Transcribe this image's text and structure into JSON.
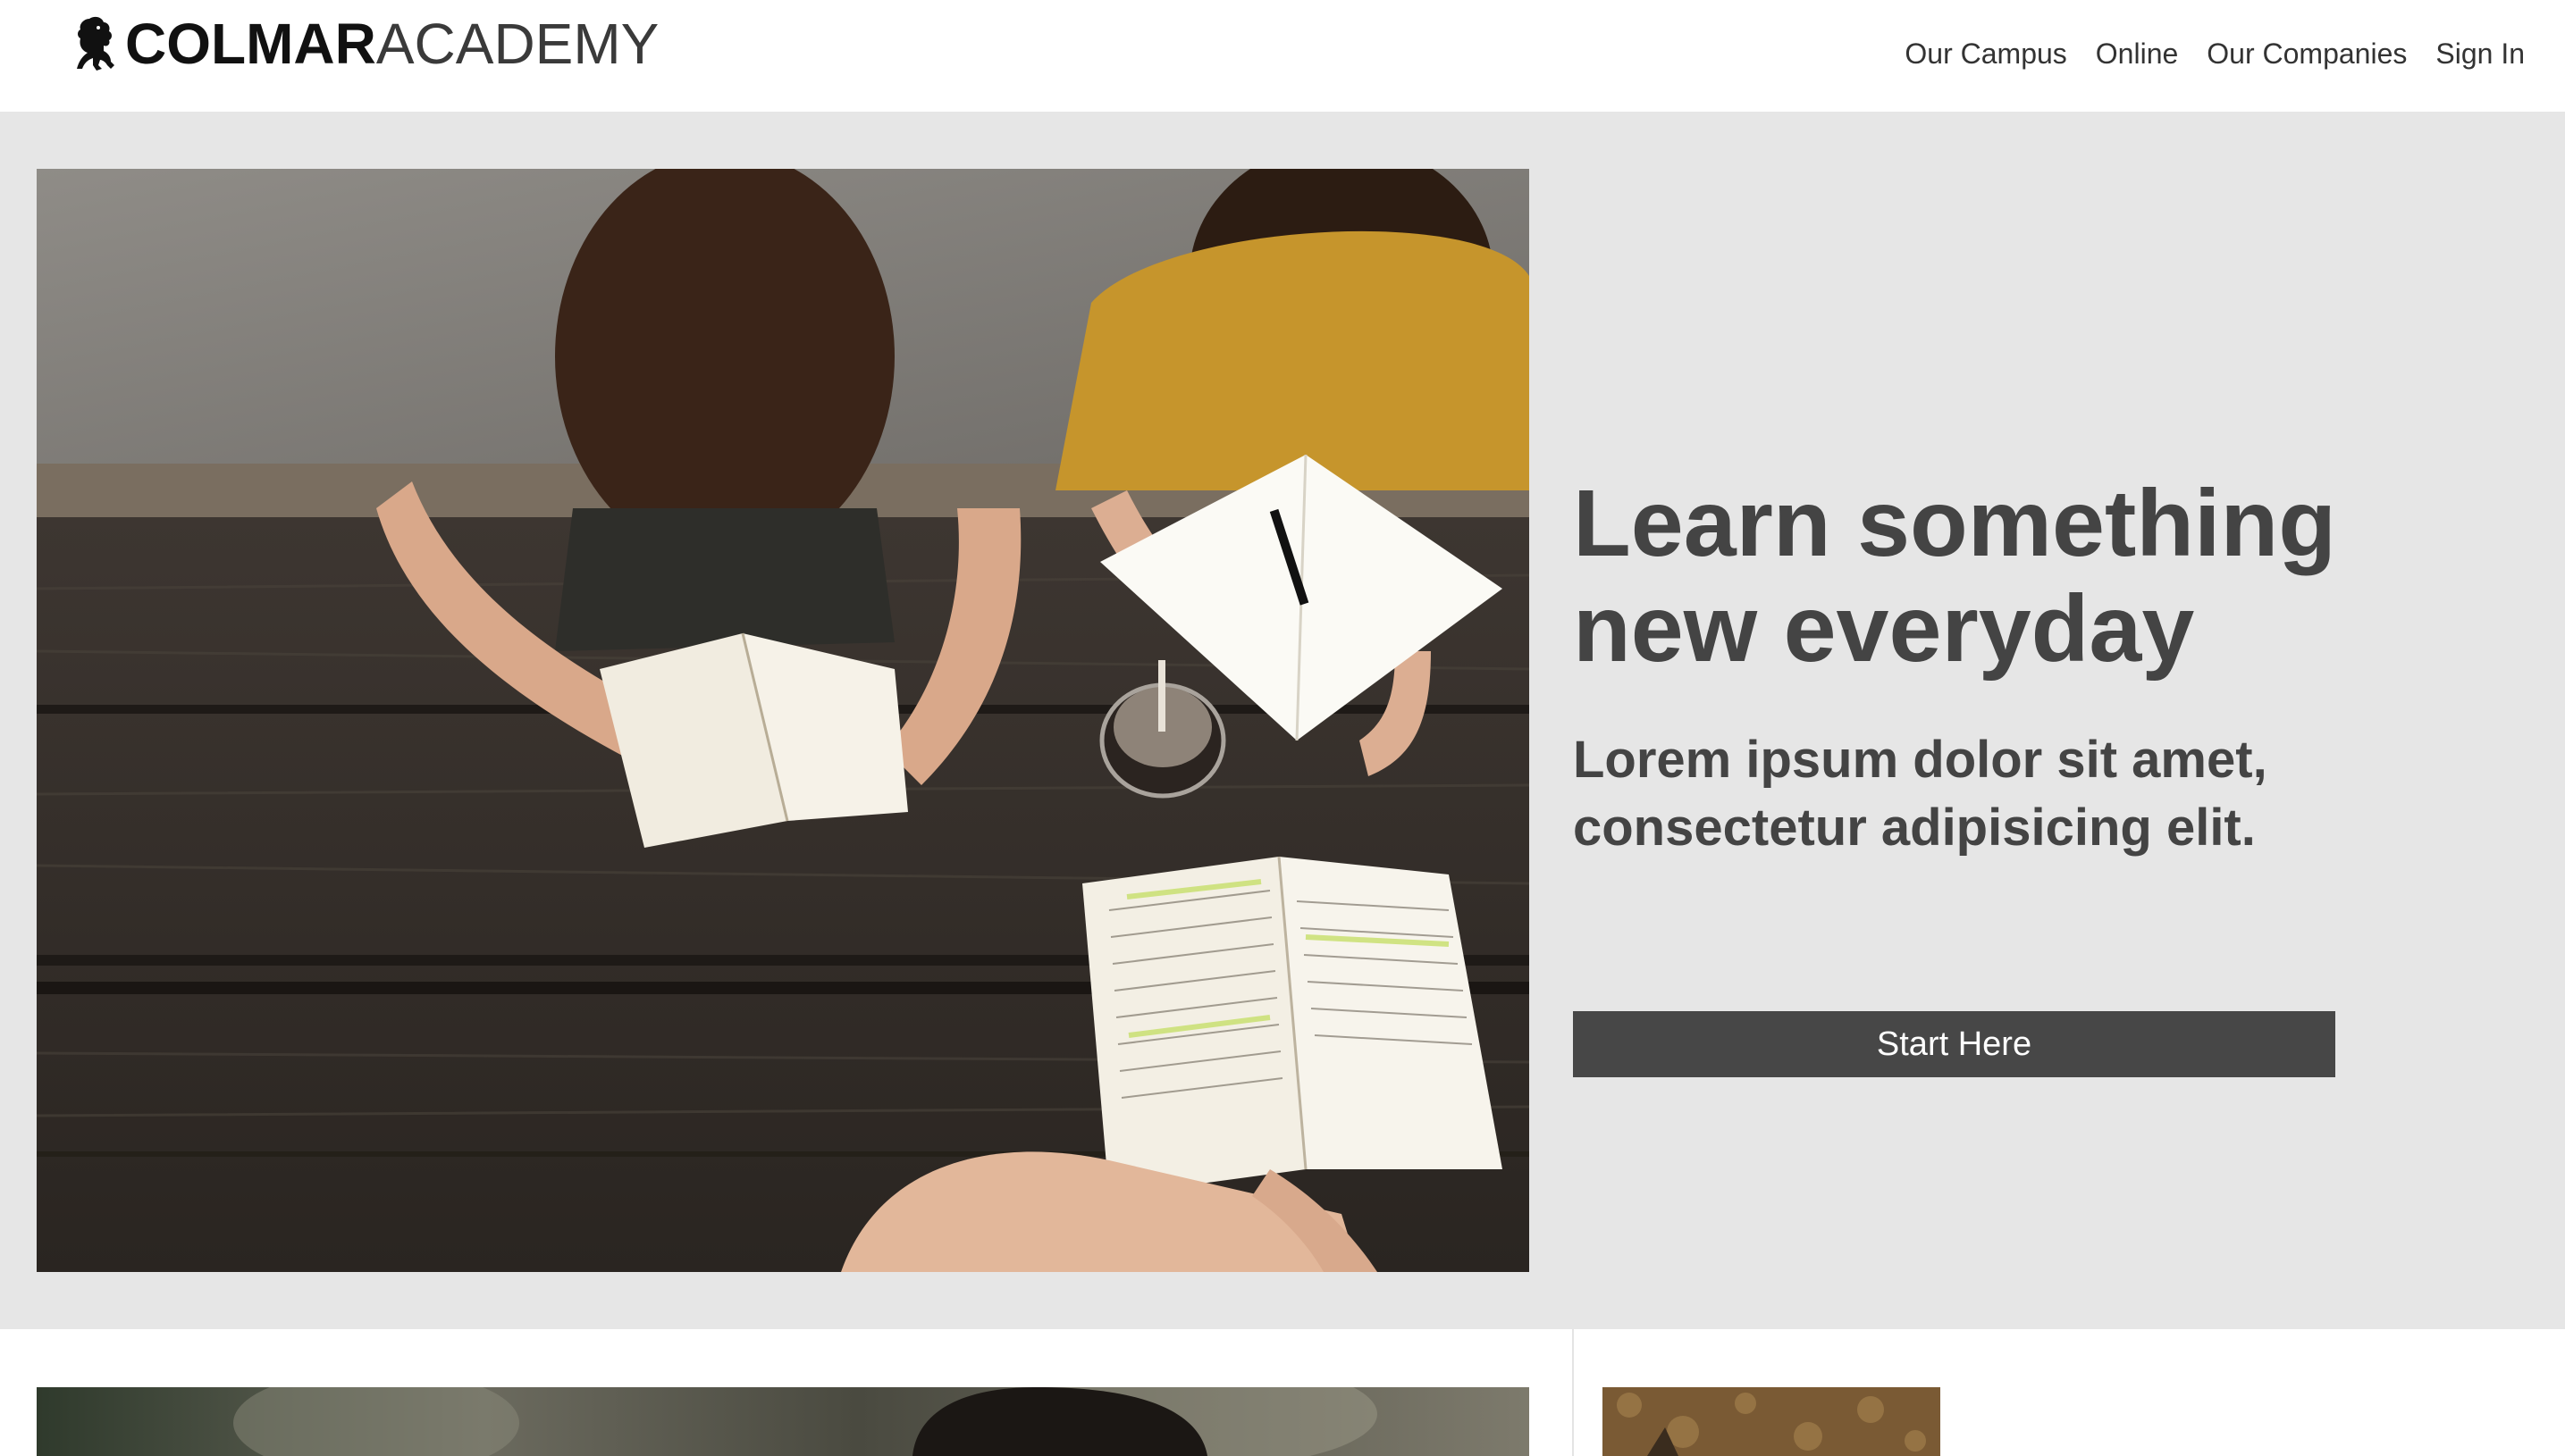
{
  "brand": {
    "name_bold": "COLMAR",
    "name_light": "ACADEMY",
    "logo_icon": "lion-icon"
  },
  "nav": {
    "items": [
      {
        "label": "Our Campus"
      },
      {
        "label": "Online"
      },
      {
        "label": "Our Companies"
      },
      {
        "label": "Sign In"
      }
    ]
  },
  "hero": {
    "title_line1": "Learn something",
    "title_line2": "new everyday",
    "subtitle_line1": "Lorem ipsum dolor sit amet,",
    "subtitle_line2": "consectetur adipisicing elit.",
    "cta_label": "Start Here"
  },
  "colors": {
    "hero_background": "#e6e6e6",
    "text": "#444444",
    "button": "#474747",
    "button_text": "#ffffff"
  }
}
